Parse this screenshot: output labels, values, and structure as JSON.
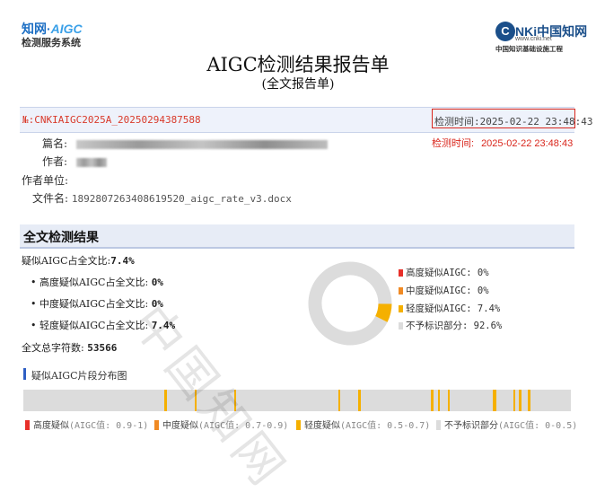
{
  "header": {
    "left_logo_line1_a": "知网·",
    "left_logo_line1_b": "AIGC",
    "left_logo_line2": "检测服务系统",
    "right_logo_mark": "C",
    "right_logo_brand": "NKi中国知网",
    "right_logo_url": "www.cnki.net",
    "right_logo_tagline": "中国知识基础设施工程",
    "title": "AIGC检测结果报告单",
    "subtitle": "(全文报告单)"
  },
  "report": {
    "id": "№:CNKIAIGC2025A_20250294387588",
    "check_time_label": "检测时间:",
    "check_time": "2025-02-22 23:48:43",
    "check_time_label2": "检测时间:",
    "check_time2": "2025-02-22  23:48:43",
    "fields": {
      "title_label": "篇名:",
      "author_label": "作者:",
      "unit_label": "作者单位:",
      "file_label": "文件名:",
      "file_name": "1892807263408619520_aigc_rate_v3.docx"
    }
  },
  "results": {
    "section_title": "全文检测结果",
    "overall_label": "疑似AIGC占全文比:",
    "overall_value": "7.4%",
    "high_label": "• 高度疑似AIGC占全文比:",
    "high_value": "0%",
    "mid_label": "• 中度疑似AIGC占全文比:",
    "mid_value": "0%",
    "low_label": "• 轻度疑似AIGC占全文比:",
    "low_value": "7.4%",
    "chars_label": "全文总字符数:",
    "chars_value": "53566",
    "legend": [
      {
        "label": "高度疑似AIGC: 0%",
        "color": "#e8302a"
      },
      {
        "label": "中度疑似AIGC: 0%",
        "color": "#f08a24"
      },
      {
        "label": "轻度疑似AIGC: 7.4%",
        "color": "#f5b000"
      },
      {
        "label": "不予标识部分: 92.6%",
        "color": "#dcdcdc"
      }
    ]
  },
  "chart_data": {
    "type": "pie",
    "categories": [
      "高度疑似AIGC",
      "中度疑似AIGC",
      "轻度疑似AIGC",
      "不予标识部分"
    ],
    "values": [
      0,
      0,
      7.4,
      92.6
    ],
    "colors": [
      "#e8302a",
      "#f08a24",
      "#f5b000",
      "#dcdcdc"
    ]
  },
  "distribution": {
    "title": "疑似AIGC片段分布图",
    "segments": [
      {
        "start": 0.257,
        "end": 0.262
      },
      {
        "start": 0.313,
        "end": 0.317
      },
      {
        "start": 0.385,
        "end": 0.389
      },
      {
        "start": 0.575,
        "end": 0.579
      },
      {
        "start": 0.612,
        "end": 0.616
      },
      {
        "start": 0.745,
        "end": 0.749
      },
      {
        "start": 0.758,
        "end": 0.761
      },
      {
        "start": 0.775,
        "end": 0.779
      },
      {
        "start": 0.858,
        "end": 0.864
      },
      {
        "start": 0.895,
        "end": 0.899
      },
      {
        "start": 0.905,
        "end": 0.91
      },
      {
        "start": 0.922,
        "end": 0.927
      }
    ],
    "legend": [
      {
        "label": "高度疑似",
        "note": "(AIGC值: 0.9-1)",
        "color": "#e8302a"
      },
      {
        "label": "中度疑似",
        "note": "(AIGC值: 0.7-0.9)",
        "color": "#f08a24"
      },
      {
        "label": "轻度疑似",
        "note": "(AIGC值: 0.5-0.7)",
        "color": "#f5b000"
      },
      {
        "label": "不予标识部分",
        "note": "(AIGC值: 0-0.5)",
        "color": "#dcdcdc"
      }
    ]
  },
  "watermark": "中国知网"
}
